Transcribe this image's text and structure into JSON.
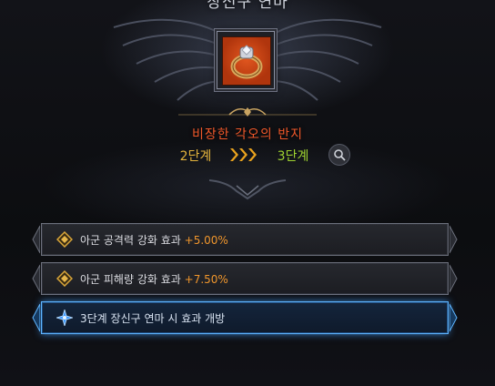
{
  "window": {
    "title": "장신구 연마"
  },
  "item": {
    "name": "비장한 각오의 반지",
    "icon": "ring-icon"
  },
  "stage": {
    "from": "2단계",
    "to": "3단계",
    "search_icon": "search-icon"
  },
  "effects": [
    {
      "label": "아군 공격력 강화 효과",
      "value": "+5.00%",
      "icon": "diamond-icon"
    },
    {
      "label": "아군 피해량 강화 효과",
      "value": "+7.50%",
      "icon": "diamond-icon"
    },
    {
      "label": "3단계 장신구 연마 시 효과 개방",
      "value": "",
      "icon": "locked-star-icon",
      "highlighted": true
    }
  ],
  "colors": {
    "item_name": "#f0582a",
    "stage_from": "#e3b33c",
    "stage_to": "#9ed230",
    "effect_value": "#f0962c",
    "highlight_border": "#5fb5ff"
  }
}
